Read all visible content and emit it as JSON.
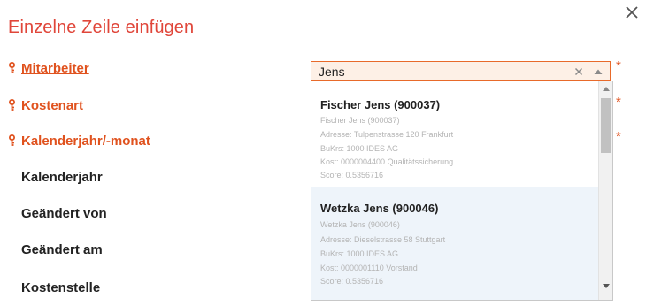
{
  "dialog": {
    "title": "Einzelne Zeile einfügen"
  },
  "fields": {
    "mitarbeiter": "Mitarbeiter",
    "kostenart": "Kostenart",
    "kalenderjahr_monat": "Kalenderjahr/-monat",
    "kalenderjahr": "Kalenderjahr",
    "geaendert_von": "Geändert von",
    "geaendert_am": "Geändert am",
    "kostenstelle": "Kostenstelle",
    "required_marker": "*"
  },
  "combo": {
    "value": "Jens"
  },
  "options": [
    {
      "title": "Fischer Jens (900037)",
      "lines": [
        "Fischer Jens (900037)",
        "Adresse: Tulpenstrasse 120 Frankfurt",
        "BuKrs: 1000 IDES AG",
        "Kost: 0000004400 Qualitätssicherung",
        "Score: 0.5356716"
      ]
    },
    {
      "title": "Wetzka Jens (900046)",
      "lines": [
        "Wetzka Jens (900046)",
        "Adresse: Dieselstrasse 58 Stuttgart",
        "BuKrs: 1000 IDES AG",
        "Kost: 0000001110 Vorstand",
        "Score: 0.5356716"
      ]
    }
  ],
  "colors": {
    "title": "#e0463a",
    "required_label": "#e0521e",
    "combo_border": "#e86a2a",
    "combo_bg": "#fdf0e6",
    "highlight_row": "#eef4fa"
  },
  "icons": {
    "close": "close-icon",
    "key": "key-icon",
    "clear": "clear-icon",
    "toggle": "caret-up-icon"
  }
}
